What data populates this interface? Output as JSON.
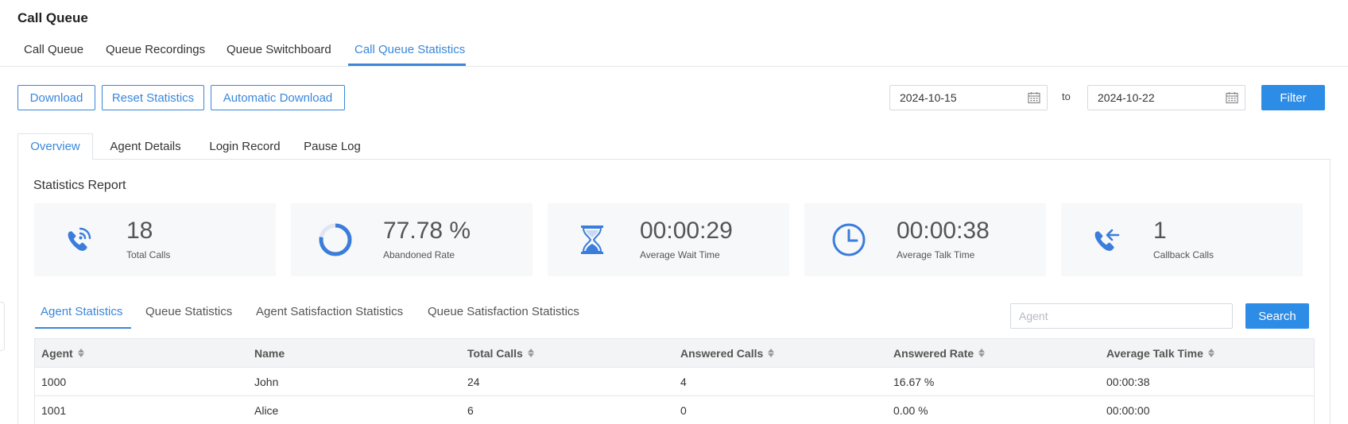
{
  "page": {
    "title": "Call Queue"
  },
  "top_tabs": [
    {
      "label": "Call Queue"
    },
    {
      "label": "Queue Recordings"
    },
    {
      "label": "Queue Switchboard"
    },
    {
      "label": "Call Queue Statistics",
      "active": true
    }
  ],
  "toolbar": {
    "download_label": "Download",
    "reset_label": "Reset Statistics",
    "auto_download_label": "Automatic Download",
    "start_date": "2024-10-15",
    "to_label": "to",
    "end_date": "2024-10-22",
    "filter_label": "Filter"
  },
  "sub_tabs": [
    {
      "label": "Overview",
      "active": true
    },
    {
      "label": "Agent Details"
    },
    {
      "label": "Login Record"
    },
    {
      "label": "Pause Log"
    }
  ],
  "report": {
    "title": "Statistics Report",
    "cards": [
      {
        "icon": "phone-wifi-icon",
        "value": "18",
        "label": "Total Calls"
      },
      {
        "icon": "ring-progress-icon",
        "value": "77.78 %",
        "label": "Abandoned Rate",
        "progress": 0.7778
      },
      {
        "icon": "hourglass-icon",
        "value": "00:00:29",
        "label": "Average Wait Time"
      },
      {
        "icon": "clock-icon",
        "value": "00:00:38",
        "label": "Average Talk Time"
      },
      {
        "icon": "phone-callback-icon",
        "value": "1",
        "label": "Callback Calls"
      }
    ]
  },
  "stats_tabs": [
    {
      "label": "Agent Statistics",
      "active": true
    },
    {
      "label": "Queue Statistics"
    },
    {
      "label": "Agent Satisfaction Statistics"
    },
    {
      "label": "Queue Satisfaction Statistics"
    }
  ],
  "search": {
    "placeholder": "Agent",
    "button_label": "Search"
  },
  "table": {
    "columns": [
      "Agent",
      "Name",
      "Total Calls",
      "Answered Calls",
      "Answered Rate",
      "Average Talk Time"
    ],
    "rows": [
      [
        "1000",
        "John",
        "24",
        "4",
        "16.67 %",
        "00:00:38"
      ],
      [
        "1001",
        "Alice",
        "6",
        "0",
        "0.00 %",
        "00:00:00"
      ]
    ]
  },
  "colors": {
    "accent": "#3a87d9",
    "primary_button": "#2d8ce6",
    "icon": "#3b7ddb",
    "card_bg": "#f7f8fa"
  }
}
